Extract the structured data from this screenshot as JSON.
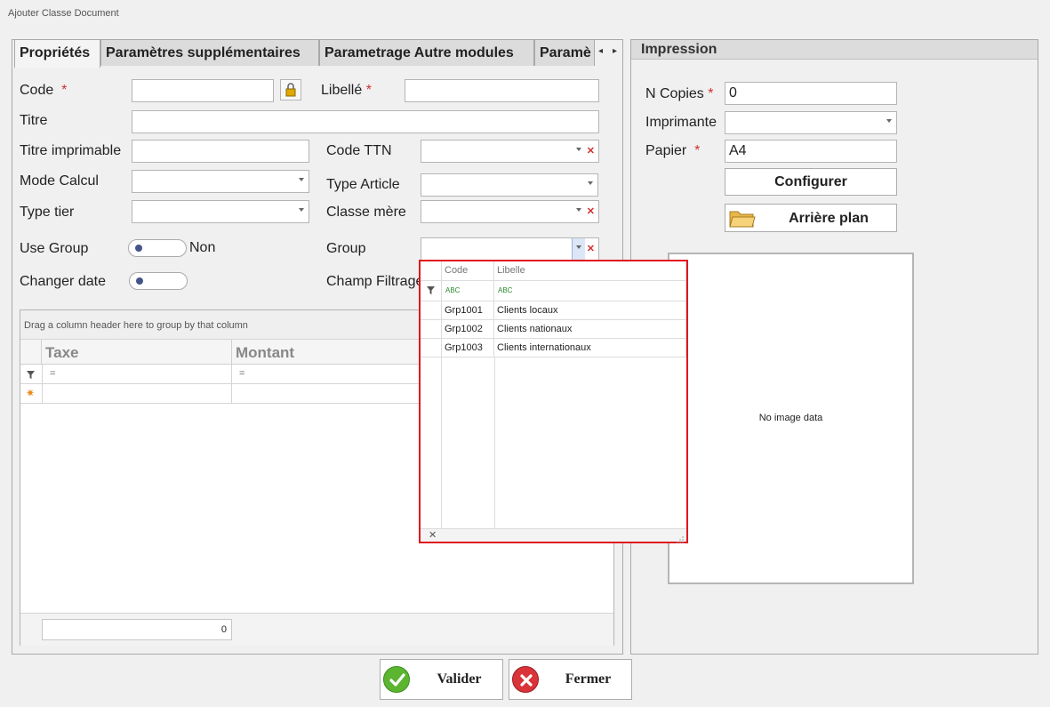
{
  "window": {
    "title": "Ajouter Classe Document"
  },
  "tabs": [
    {
      "label": "Propriétés"
    },
    {
      "label": "Paramètres supplémentaires"
    },
    {
      "label": "Parametrage Autre modules"
    },
    {
      "label": "Paramè"
    }
  ],
  "form": {
    "code_label": "Code",
    "libelle_label": "Libellé",
    "titre_label": "Titre",
    "titre_imprimable_label": "Titre imprimable",
    "code_ttn_label": "Code TTN",
    "mode_calcul_label": "Mode Calcul",
    "type_article_label": "Type Article",
    "type_tier_label": "Type tier",
    "classe_mere_label": "Classe mère",
    "use_group_label": "Use Group",
    "use_group_value": "Non",
    "group_label": "Group",
    "changer_date_label": "Changer date",
    "champ_filtrage_label": "Champ Filtrage",
    "required_mark": "*"
  },
  "grid": {
    "group_hint": "Drag a column header here to group by that column",
    "columns": [
      "Taxe",
      "Montant"
    ],
    "filter_symbol": "=",
    "new_row_symbol": "✷",
    "footer_total": "0"
  },
  "impression": {
    "title": "Impression",
    "n_copies_label": "N Copies",
    "n_copies_value": "0",
    "imprimante_label": "Imprimante",
    "papier_label": "Papier",
    "papier_value": "A4",
    "configurer_label": "Configurer",
    "arriere_plan_label": "Arrière plan",
    "image_placeholder": "No image data"
  },
  "group_popup": {
    "columns": [
      "Code",
      "Libelle"
    ],
    "filter_symbol": "ABC",
    "rows": [
      {
        "code": "Grp1001",
        "libelle": "Clients locaux"
      },
      {
        "code": "Grp1002",
        "libelle": "Clients nationaux"
      },
      {
        "code": "Grp1003",
        "libelle": "Clients internationaux"
      }
    ],
    "close_symbol": "✕"
  },
  "actions": {
    "valider_label": "Valider",
    "fermer_label": "Fermer"
  },
  "colors": {
    "required": "#d32f2f",
    "popup_border": "#e0161f",
    "valider_icon": "#5cb531",
    "fermer_icon": "#d9343a"
  },
  "icons": {
    "lock": "lock-icon",
    "folder": "folder-icon",
    "check": "check-icon",
    "cancel": "cancel-icon",
    "filter": "filter-icon"
  }
}
